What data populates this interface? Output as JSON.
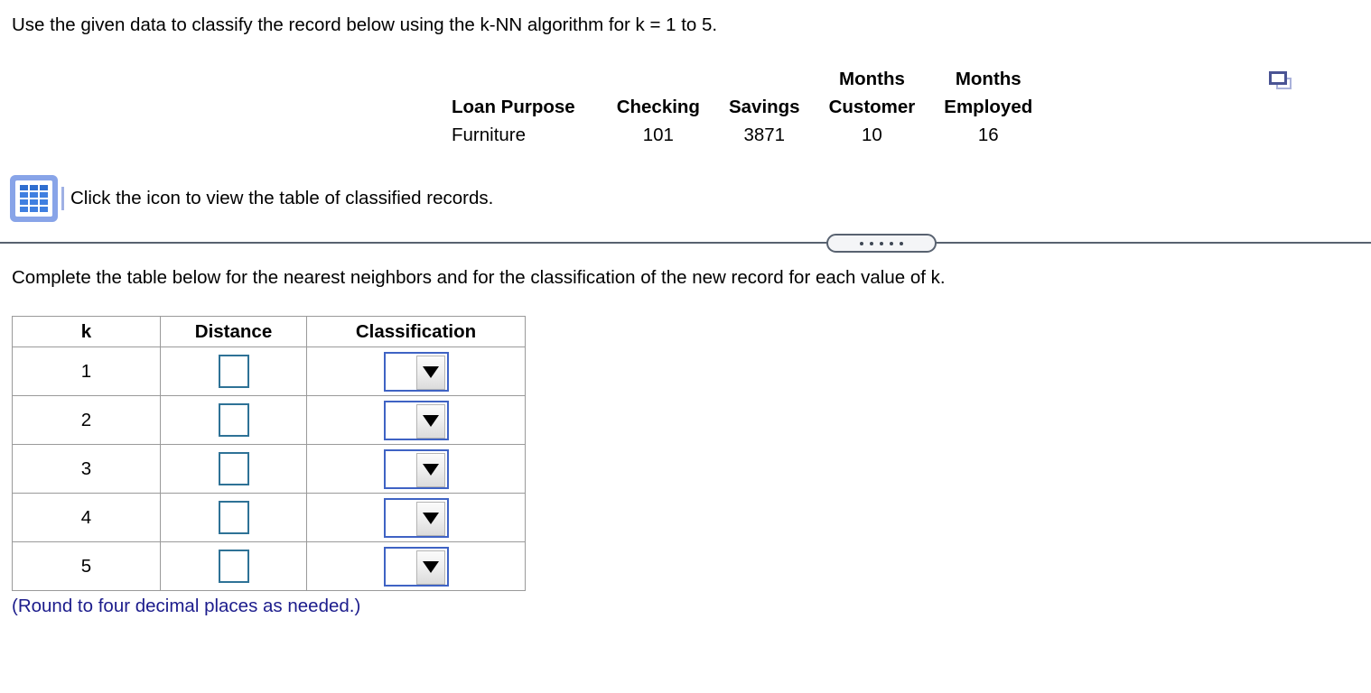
{
  "prompt": "Use the given data to classify the record below using the k-NN algorithm for k = 1 to 5.",
  "record": {
    "headers": [
      "Loan Purpose",
      "Checking",
      "Savings",
      "Months\nCustomer",
      "Months\nEmployed"
    ],
    "values": [
      "Furniture",
      "101",
      "3871",
      "10",
      "16"
    ]
  },
  "duplicate_icon": {
    "name": "duplicate-window-icon",
    "front_color": "#4a5494",
    "back_color": "#a9b1da"
  },
  "table_popup": {
    "icon_name": "table-grid-icon",
    "icon_bg": "#88a4e8",
    "caption": "Click the icon to view the table of classified records."
  },
  "divider": {
    "pill_dots": 5,
    "line_color": "#586270"
  },
  "instruction2": "Complete the table below for the nearest neighbors and for the classification of the new record for each value of k.",
  "answer_table": {
    "headers": [
      "k",
      "Distance",
      "Classification"
    ],
    "rows": [
      {
        "k": "1",
        "distance": "",
        "classification": ""
      },
      {
        "k": "2",
        "distance": "",
        "classification": ""
      },
      {
        "k": "3",
        "distance": "",
        "classification": ""
      },
      {
        "k": "4",
        "distance": "",
        "classification": ""
      },
      {
        "k": "5",
        "distance": "",
        "classification": ""
      }
    ],
    "input_border_color": "#2e7296",
    "dropdown_border_color": "#3f63c4"
  },
  "round_note": {
    "text": "(Round to four decimal places as needed.)",
    "color": "#1c1c8c"
  }
}
